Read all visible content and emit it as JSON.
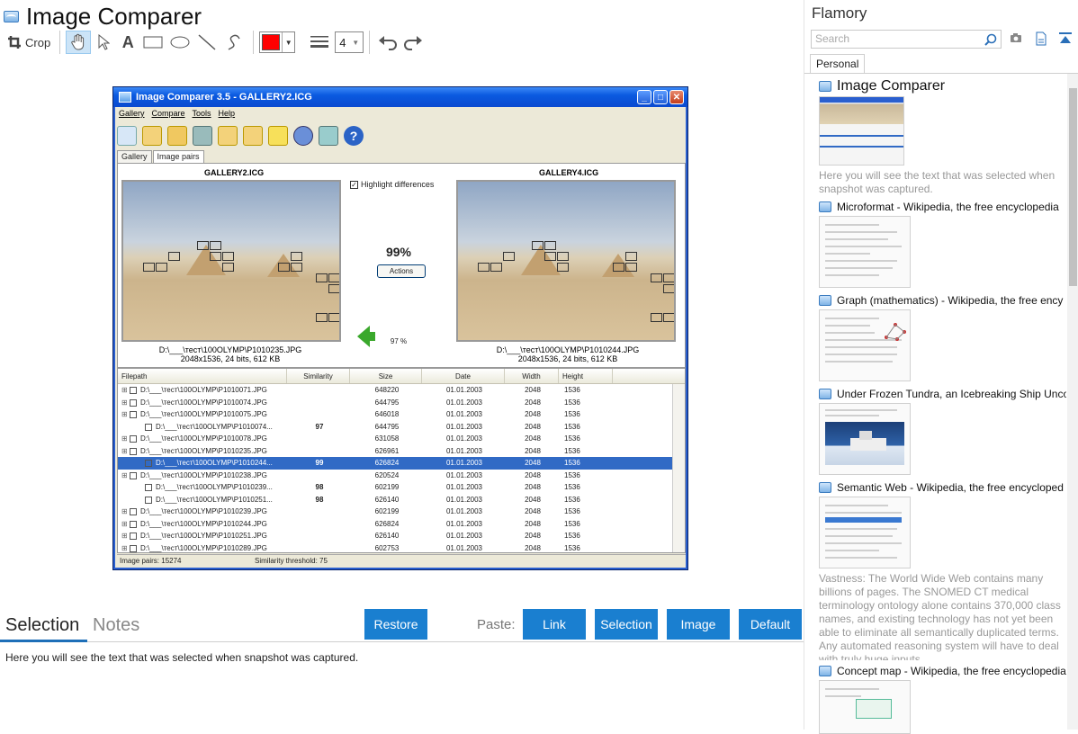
{
  "app": {
    "title": "Image Comparer"
  },
  "toolbar": {
    "crop_label": "Crop",
    "line_width": "4",
    "color": "#ff0000"
  },
  "screenshot": {
    "window_title": "Image Comparer 3.5 - GALLERY2.ICG",
    "menu": [
      "Gallery",
      "Compare",
      "Tools",
      "Help"
    ],
    "tabs": [
      "Gallery",
      "Image pairs"
    ],
    "left_image_title": "GALLERY2.ICG",
    "right_image_title": "GALLERY4.ICG",
    "highlight_label": "Highlight differences",
    "similarity": "99%",
    "actions_label": "Actions",
    "threshold_pct": "97 %",
    "left_path": "D:\\___\\тест\\100OLYMP\\P1010235.JPG",
    "left_info": "2048x1536, 24 bits, 612 KB",
    "right_path": "D:\\___\\тест\\100OLYMP\\P1010244.JPG",
    "right_info": "2048x1536, 24 bits, 612 KB",
    "columns": [
      "Filepath",
      "Similarity",
      "Size",
      "Date",
      "Width",
      "Height"
    ],
    "rows": [
      {
        "path": "D:\\___\\тест\\100OLYMP\\P1010071.JPG",
        "sim": "",
        "size": "648220",
        "date": "01.01.2003",
        "w": "2048",
        "h": "1536",
        "indent": 0
      },
      {
        "path": "D:\\___\\тест\\100OLYMP\\P1010074.JPG",
        "sim": "",
        "size": "644795",
        "date": "01.01.2003",
        "w": "2048",
        "h": "1536",
        "indent": 0
      },
      {
        "path": "D:\\___\\тест\\100OLYMP\\P1010075.JPG",
        "sim": "",
        "size": "646018",
        "date": "01.01.2003",
        "w": "2048",
        "h": "1536",
        "indent": 0
      },
      {
        "path": "D:\\___\\тест\\100OLYMP\\P1010074...",
        "sim": "97",
        "size": "644795",
        "date": "01.01.2003",
        "w": "2048",
        "h": "1536",
        "indent": 1
      },
      {
        "path": "D:\\___\\тест\\100OLYMP\\P1010078.JPG",
        "sim": "",
        "size": "631058",
        "date": "01.01.2003",
        "w": "2048",
        "h": "1536",
        "indent": 0
      },
      {
        "path": "D:\\___\\тест\\100OLYMP\\P1010235.JPG",
        "sim": "",
        "size": "626961",
        "date": "01.01.2003",
        "w": "2048",
        "h": "1536",
        "indent": 0
      },
      {
        "path": "D:\\___\\тест\\100OLYMP\\P1010244...",
        "sim": "99",
        "size": "626824",
        "date": "01.01.2003",
        "w": "2048",
        "h": "1536",
        "indent": 1,
        "selected": true
      },
      {
        "path": "D:\\___\\тест\\100OLYMP\\P1010238.JPG",
        "sim": "",
        "size": "620524",
        "date": "01.01.2003",
        "w": "2048",
        "h": "1536",
        "indent": 0
      },
      {
        "path": "D:\\___\\тест\\100OLYMP\\P1010239...",
        "sim": "98",
        "size": "602199",
        "date": "01.01.2003",
        "w": "2048",
        "h": "1536",
        "indent": 1
      },
      {
        "path": "D:\\___\\тест\\100OLYMP\\P1010251...",
        "sim": "98",
        "size": "626140",
        "date": "01.01.2003",
        "w": "2048",
        "h": "1536",
        "indent": 1
      },
      {
        "path": "D:\\___\\тест\\100OLYMP\\P1010239.JPG",
        "sim": "",
        "size": "602199",
        "date": "01.01.2003",
        "w": "2048",
        "h": "1536",
        "indent": 0
      },
      {
        "path": "D:\\___\\тест\\100OLYMP\\P1010244.JPG",
        "sim": "",
        "size": "626824",
        "date": "01.01.2003",
        "w": "2048",
        "h": "1536",
        "indent": 0
      },
      {
        "path": "D:\\___\\тест\\100OLYMP\\P1010251.JPG",
        "sim": "",
        "size": "626140",
        "date": "01.01.2003",
        "w": "2048",
        "h": "1536",
        "indent": 0
      },
      {
        "path": "D:\\___\\тест\\100OLYMP\\P1010289.JPG",
        "sim": "",
        "size": "602753",
        "date": "01.01.2003",
        "w": "2048",
        "h": "1536",
        "indent": 0
      }
    ],
    "status_pairs": "Image pairs: 15274",
    "status_threshold": "Similarity threshold: 75"
  },
  "bottom": {
    "tab_selection": "Selection",
    "tab_notes": "Notes",
    "restore_label": "Restore",
    "paste_label": "Paste:",
    "link_label": "Link",
    "selection_label": "Selection",
    "image_label": "Image",
    "default_label": "Default",
    "notes_text": "Here you will see the text that was selected when snapshot was captured."
  },
  "sidebar": {
    "title": "Flamory",
    "search_placeholder": "Search",
    "tab_personal": "Personal",
    "items": [
      {
        "title": "Image Comparer",
        "desc": "Here you will see the text that was selected when snapshot was captured."
      },
      {
        "title": "Microformat - Wikipedia, the free encyclopedia",
        "desc": ""
      },
      {
        "title": "Graph (mathematics) - Wikipedia, the free ency",
        "desc": ""
      },
      {
        "title": "Under Frozen Tundra, an Icebreaking Ship Unco",
        "desc": ""
      },
      {
        "title": "Semantic Web - Wikipedia, the free encycloped",
        "desc": "Vastness: The World Wide Web contains many billions of pages. The SNOMED CT medical terminology ontology alone contains 370,000 class names, and existing technology has not yet been able to eliminate all semantically duplicated terms. Any automated reasoning system will have to deal with truly huge inputs."
      },
      {
        "title": "Concept map - Wikipedia, the free encyclopedia",
        "desc": ""
      }
    ]
  }
}
